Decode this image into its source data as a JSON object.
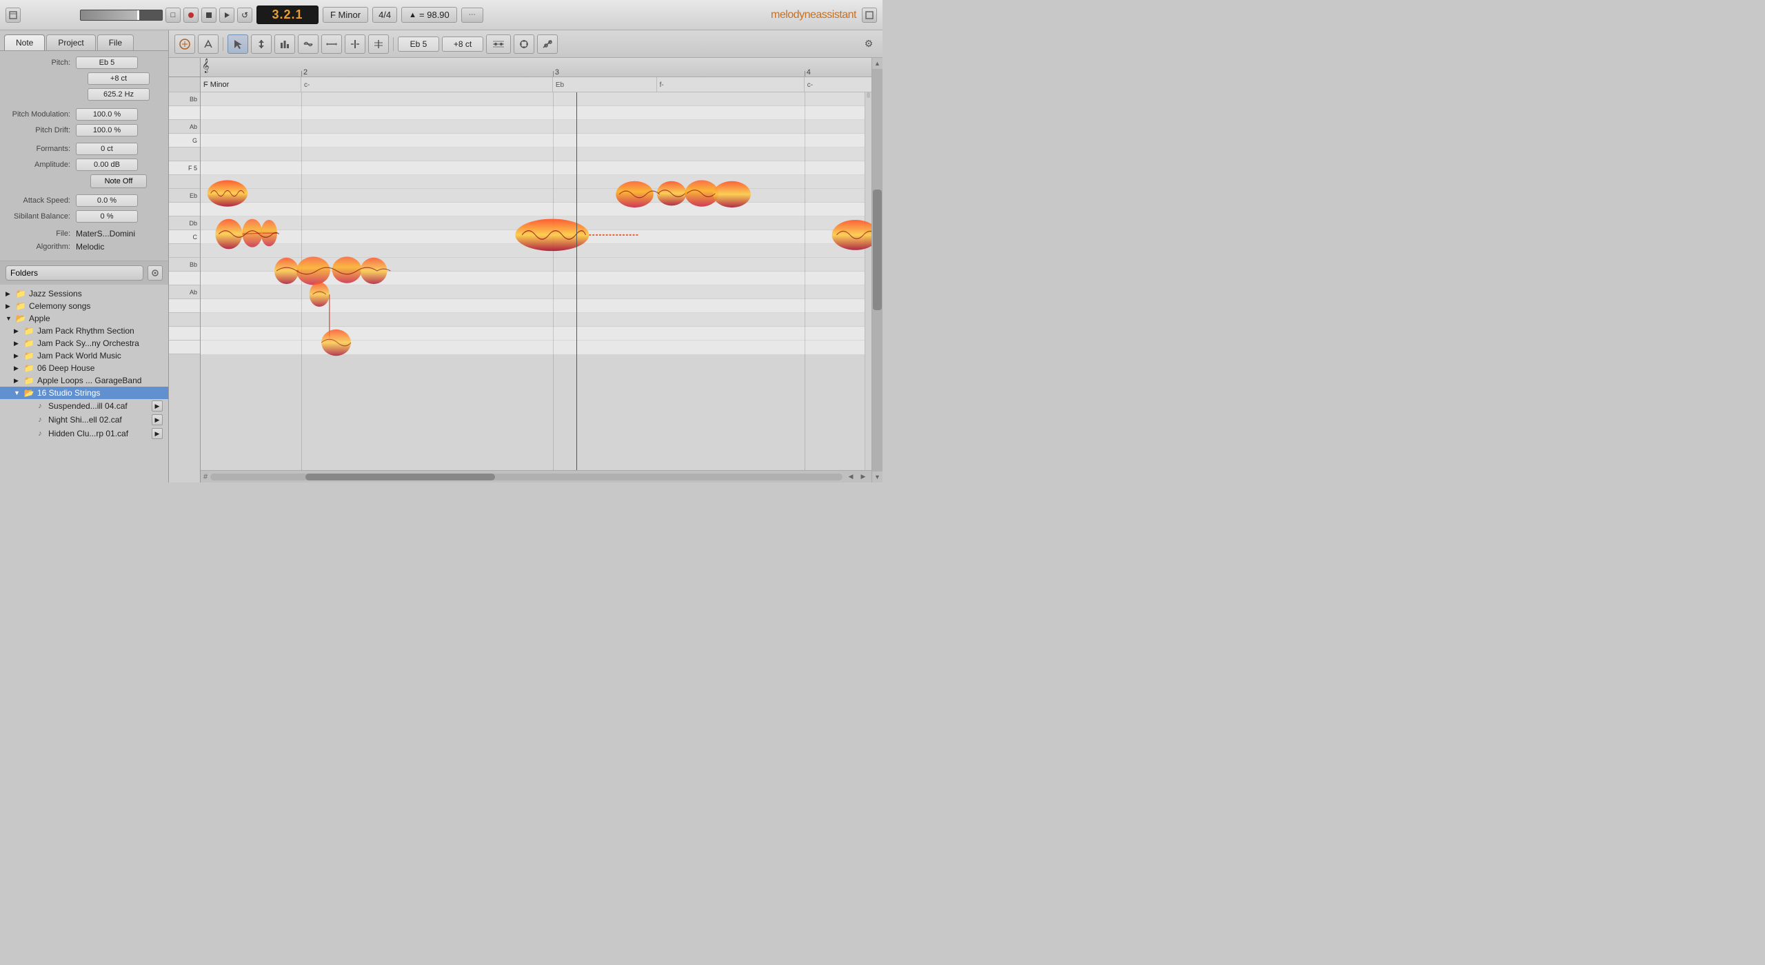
{
  "app": {
    "name_prefix": "melodyne",
    "name_suffix": "assistant",
    "window_close_icon": "□",
    "window_expand_icon": "□"
  },
  "topbar": {
    "position": "3.2.1",
    "key": "F Minor",
    "time_signature": "4/4",
    "tempo_icon": "▲",
    "tempo": "= 98.90",
    "transport": {
      "record_label": "●",
      "stop_label": "■",
      "play_label": "▶",
      "loop_label": "↺",
      "grid_label": "⊞"
    }
  },
  "toolbar": {
    "pitch_value": "Eb 5",
    "cents_value": "+8 ct",
    "tool_icons": [
      "🎵",
      "⚙",
      "↖",
      "↕",
      "≋",
      "↨",
      "↔",
      "↔",
      "⊕"
    ],
    "settings_icon": "⚙"
  },
  "note_panel": {
    "tabs": [
      {
        "id": "note",
        "label": "Note"
      },
      {
        "id": "project",
        "label": "Project"
      },
      {
        "id": "file",
        "label": "File"
      }
    ],
    "active_tab": "note",
    "pitch_label": "Pitch:",
    "pitch_value": "Eb 5",
    "cents_value": "+8 ct",
    "freq_value": "625.2 Hz",
    "pitch_mod_label": "Pitch Modulation:",
    "pitch_mod_value": "100.0 %",
    "pitch_drift_label": "Pitch Drift:",
    "pitch_drift_value": "100.0 %",
    "formants_label": "Formants:",
    "formants_value": "0 ct",
    "amplitude_label": "Amplitude:",
    "amplitude_value": "0.00 dB",
    "note_off_label": "Note Off",
    "attack_label": "Attack Speed:",
    "attack_value": "0.0 %",
    "sibilant_label": "Sibilant Balance:",
    "sibilant_value": "0 %",
    "file_label": "File:",
    "file_value": "MaterS...Domini",
    "algorithm_label": "Algorithm:",
    "algorithm_value": "Melodic"
  },
  "browser": {
    "folder_select_value": "Folders",
    "items": [
      {
        "id": "jazz",
        "level": 0,
        "label": "Jazz Sessions",
        "type": "folder",
        "expanded": false
      },
      {
        "id": "celemony",
        "level": 0,
        "label": "Celemony songs",
        "type": "folder",
        "expanded": false
      },
      {
        "id": "apple",
        "level": 0,
        "label": "Apple",
        "type": "folder",
        "expanded": true
      },
      {
        "id": "jam-rhythm",
        "level": 1,
        "label": "Jam Pack Rhythm Section",
        "type": "folder",
        "expanded": false
      },
      {
        "id": "jam-orchestra",
        "level": 1,
        "label": "Jam Pack Sy...ny Orchestra",
        "type": "folder",
        "expanded": false
      },
      {
        "id": "jam-world",
        "level": 1,
        "label": "Jam Pack World Music",
        "type": "folder",
        "expanded": false
      },
      {
        "id": "deep-house",
        "level": 1,
        "label": "06 Deep House",
        "type": "folder",
        "expanded": false
      },
      {
        "id": "apple-loops",
        "level": 1,
        "label": "Apple Loops ... GarageBand",
        "type": "folder",
        "expanded": false
      },
      {
        "id": "studio-strings",
        "level": 1,
        "label": "16 Studio Strings",
        "type": "folder",
        "expanded": true,
        "selected": true
      },
      {
        "id": "file1",
        "level": 2,
        "label": "Suspended...ill 04.caf",
        "type": "file"
      },
      {
        "id": "file2",
        "level": 2,
        "label": "Night Shi...ell 02.caf",
        "type": "file"
      },
      {
        "id": "file3",
        "level": 2,
        "label": "Hidden Clu...rp 01.caf",
        "type": "file"
      }
    ]
  },
  "editor": {
    "key_label": "F Minor",
    "chord_markers": [
      {
        "label": "f-",
        "position_pct": 0
      },
      {
        "label": "c-",
        "position_pct": 15
      },
      {
        "label": "Eb",
        "position_pct": 52.5
      },
      {
        "label": "f-",
        "position_pct": 68
      },
      {
        "label": "c-",
        "position_pct": 90
      }
    ],
    "ruler_marks": [
      {
        "label": "2",
        "position_pct": 15
      },
      {
        "label": "3",
        "position_pct": 52.5
      },
      {
        "label": "4",
        "position_pct": 90
      }
    ],
    "piano_keys": [
      {
        "note": "Bb",
        "type": "black"
      },
      {
        "note": "",
        "type": "white"
      },
      {
        "note": "Ab",
        "type": "black"
      },
      {
        "note": "",
        "type": "white"
      },
      {
        "note": "G",
        "type": "white"
      },
      {
        "note": "",
        "type": "black"
      },
      {
        "note": "F 5",
        "type": "white"
      },
      {
        "note": "",
        "type": "black"
      },
      {
        "note": "Eb",
        "type": "black"
      },
      {
        "note": "",
        "type": "white"
      },
      {
        "note": "Db",
        "type": "black"
      },
      {
        "note": "",
        "type": "white"
      },
      {
        "note": "C",
        "type": "white"
      },
      {
        "note": "",
        "type": "black"
      },
      {
        "note": "Bb",
        "type": "black"
      },
      {
        "note": "",
        "type": "white"
      },
      {
        "note": "Ab",
        "type": "black"
      }
    ],
    "cursor_position_pct": 56,
    "bottom_scroll_hash": "#"
  }
}
